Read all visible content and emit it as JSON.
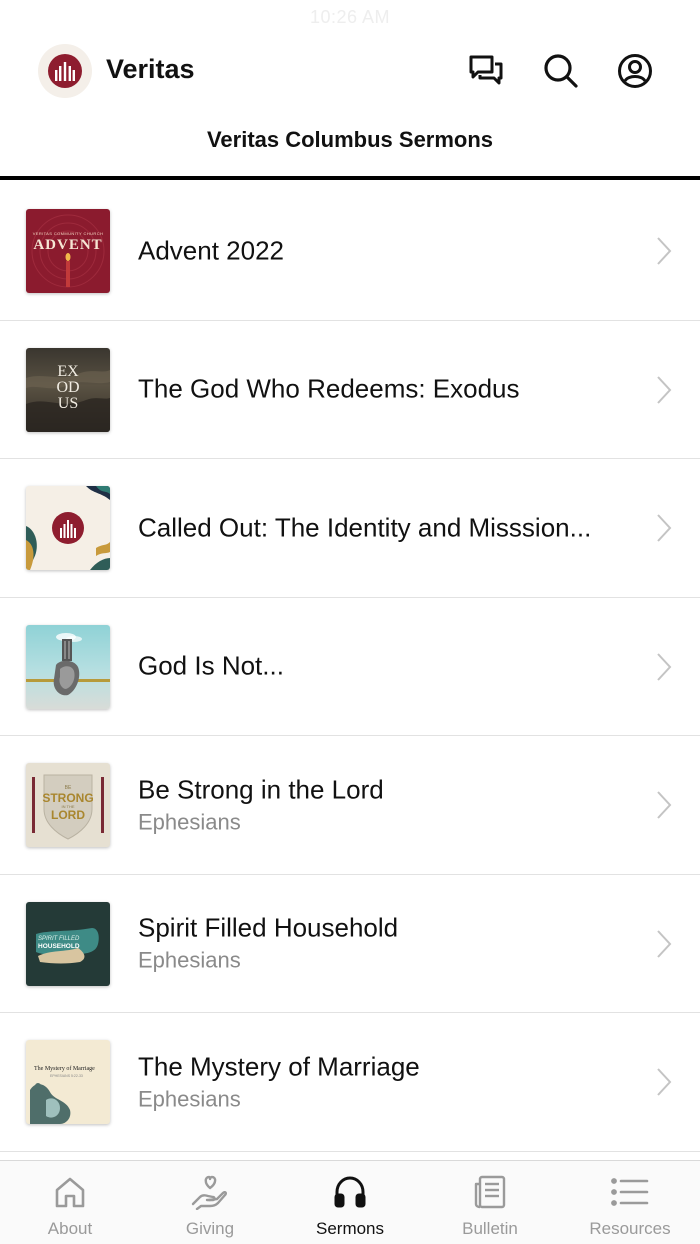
{
  "status_bar": {
    "time": "10:26 AM"
  },
  "header": {
    "app_name": "Veritas"
  },
  "page": {
    "title": "Veritas Columbus Sermons"
  },
  "sermons": [
    {
      "title": "Advent 2022",
      "subtitle": "",
      "thumb_text": "ADVENT",
      "thumb_caption": "VERITAS COMMUNITY CHURCH"
    },
    {
      "title": "The God Who Redeems: Exodus",
      "subtitle": "",
      "thumb_text": "EX OD US"
    },
    {
      "title": "Called Out: The Identity and Misssion...",
      "subtitle": ""
    },
    {
      "title": "God Is Not...",
      "subtitle": ""
    },
    {
      "title": "Be Strong in the Lord",
      "subtitle": "Ephesians",
      "thumb_top": "BE",
      "thumb_mid": "STRONG",
      "thumb_small": "IN THE",
      "thumb_bottom": "LORD"
    },
    {
      "title": "Spirit Filled Household",
      "subtitle": "Ephesians",
      "thumb_line1": "SPIRIT FILLED",
      "thumb_line2": "HOUSEHOLD"
    },
    {
      "title": "The Mystery of Marriage",
      "subtitle": "Ephesians",
      "thumb_line1": "The Mystery of Marriage",
      "thumb_line2": "EPHESIANS 5:22-33"
    }
  ],
  "tabs": [
    {
      "label": "About",
      "icon": "home-icon"
    },
    {
      "label": "Giving",
      "icon": "giving-hand-heart-icon"
    },
    {
      "label": "Sermons",
      "icon": "headphones-icon",
      "active": true
    },
    {
      "label": "Bulletin",
      "icon": "newspaper-icon"
    },
    {
      "label": "Resources",
      "icon": "list-icon"
    }
  ],
  "colors": {
    "brand": "#8e1d2f",
    "text": "#111111",
    "muted": "#8a8a8a",
    "divider": "#e2e2e2"
  }
}
